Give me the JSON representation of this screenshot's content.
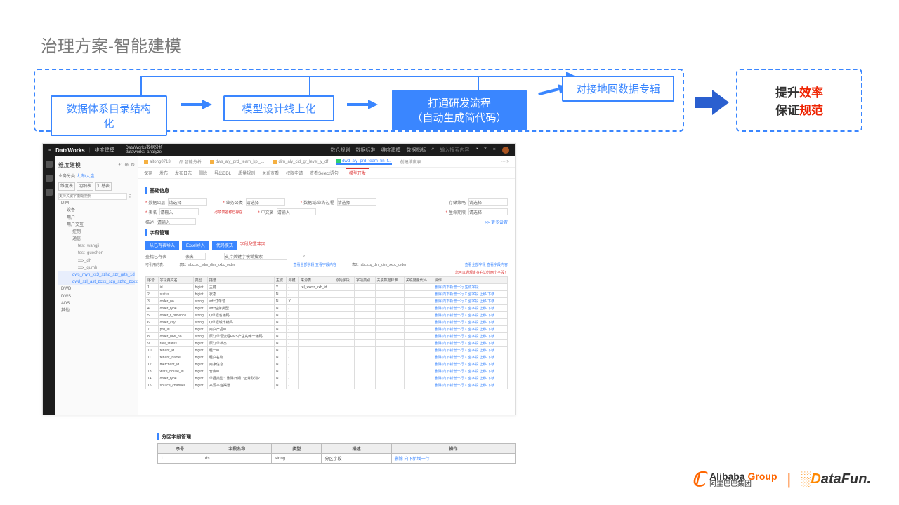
{
  "title": "治理方案-智能建模",
  "flow": {
    "step1": "数据体系目录结构化",
    "step2": "模型设计线上化",
    "step3_line1": "打通研发流程",
    "step3_line2": "（自动生成简代码）",
    "step4": "对接地图数据专辑"
  },
  "result": {
    "line1_black": "提升",
    "line1_red": "效率",
    "line2_black": "保证",
    "line2_red": "规范"
  },
  "mock": {
    "brand": "DataWorks",
    "brand_section": "维度建模",
    "project_line1": "DataWorks数据分析",
    "project_line2": "dataworks_analyze",
    "top_links": [
      "数仓规划",
      "数据标准",
      "维度建模",
      "数据指标"
    ],
    "search_placeholder": "输入搜索内容",
    "tree": {
      "header": "维度建模",
      "view_label": "业务分类",
      "view_value": "大淘/大盘",
      "side_tabs": [
        "维度表",
        "明细表",
        "汇总表"
      ],
      "DIM": "DIM",
      "DIM_children": [
        "设备",
        "用户"
      ],
      "user_inter": "用户交互",
      "user_inter_children": [
        "控制",
        "通信"
      ],
      "leaf_items": [
        "test_wangji",
        "test_guochen",
        "xxx_dh",
        "xxx_qumh"
      ],
      "active1": "dws_myn_xx3_szhd_szr_grts_1d",
      "active2": "dwd_szl_ast_zcxx_szg_szhd_zcxxx",
      "DWD": "DWD",
      "DWS": "DWS",
      "ADS": "ADS",
      "temp": "其他"
    },
    "tabs": [
      "aitong0713",
      "智能分析",
      "dws_aly_prd_team_kpi_...",
      "dim_aly_cid_gr_level_y_df",
      "dwd_aly_prd_team_fin_f...",
      "创建维度表"
    ],
    "ops": [
      "保存",
      "发布",
      "发布日志",
      "删除",
      "导出DDL",
      "质量规则",
      "关系查看",
      "权限申请",
      "查看Select语句"
    ],
    "ops_highlight": "模型开发",
    "section_basic": "基础信息",
    "form": {
      "data_domain_label": "数据公层",
      "data_domain_value": "请选择",
      "biz_type_label": "业务公类",
      "biz_type_value": "请选择",
      "data_bc_label": "数据域/业务过程",
      "data_bc_value": "请选择",
      "store_label": "存储策略",
      "store_value": "请选择",
      "table_name_label": "表名",
      "table_name_ph": "请输入",
      "table_name_warn": "必填表名称已存在",
      "cn_name_label": "中文名",
      "cn_name_ph": "请输入",
      "life_label": "生命期限",
      "life_value": "请选择",
      "desc_label": "描述",
      "desc_ph": "请输入",
      "more": ">> 更多设置"
    },
    "section_field": "字段管理",
    "field_btns": [
      "从已有表导入",
      "Excel导入",
      "代码模式"
    ],
    "field_warn_btn": "字段配置冲突",
    "filter_label": "查找已有表",
    "filter_type": "表名",
    "filter_ph": "支持关键字模糊搜索",
    "ref_label": "可引用的表:",
    "ref_value1": "表1：abcxxq_xdm_dim_xxbc_order",
    "ref_link1": "查看全部字段   查看字段内容",
    "ref_value2": "表2：abcxxq_dim_dim_xxbc_order",
    "ref_link2": "查看全部字段   查看字段内容",
    "ref_warn": "您可以通规定在右边分两个字段！",
    "table": {
      "headers": [
        "序号",
        "字段英文名",
        "类型",
        "描述",
        "主键",
        "外键",
        "来源表",
        "原始字段",
        "字段类别",
        "关联数据标准",
        "关联度量代码",
        "操作"
      ],
      "rows": [
        {
          "n": "1",
          "en": "id",
          "t": "bigint",
          "d": "主键",
          "pk": "Y",
          "fk": "-",
          "src": "rel_xxxxr_xxb_id",
          "ops": "删除 向下新增一行 生成字段"
        },
        {
          "n": "2",
          "en": "status",
          "t": "bigint",
          "d": "状态",
          "pk": "N",
          "fk": "-",
          "src": "",
          "ops": "删除 向下新增一行 X.全字段 上移 下移"
        },
        {
          "n": "3",
          "en": "order_no",
          "t": "string",
          "d": "adx订单号",
          "pk": "N",
          "fk": "Y",
          "src": "",
          "ops": "删除 向下新增一行 X.全字段 上移 下移"
        },
        {
          "n": "4",
          "en": "order_type",
          "t": "bigint",
          "d": "adx任务类型",
          "pk": "N",
          "fk": "-",
          "src": "",
          "ops": "删除 向下新增一行 X.全字段 上移 下移"
        },
        {
          "n": "5",
          "en": "order_f_province",
          "t": "string",
          "d": "Q单据省编码",
          "pk": "N",
          "fk": "-",
          "src": "",
          "ops": "删除 向下新增一行 X.全字段 上移 下移"
        },
        {
          "n": "6",
          "en": "order_city",
          "t": "string",
          "d": "Q单据城市编码",
          "pk": "N",
          "fk": "-",
          "src": "",
          "ops": "删除 向下新增一行 X.全字段 上移 下移"
        },
        {
          "n": "7",
          "en": "prd_id",
          "t": "bigint",
          "d": "商户产品id",
          "pk": "N",
          "fk": "-",
          "src": "",
          "ops": "删除 向下新增一行 X.全字段 上移 下移"
        },
        {
          "n": "8",
          "en": "order_raw_no",
          "t": "string",
          "d": "原订单号流程PMS产生的唯一编码",
          "pk": "N",
          "fk": "-",
          "src": "",
          "ops": "删除 向下新增一行 X.全字段 上移 下移"
        },
        {
          "n": "9",
          "en": "raw_status",
          "t": "bigint",
          "d": "原订单状态",
          "pk": "N",
          "fk": "-",
          "src": "",
          "ops": "删除 向下新增一行 X.全字段 上移 下移"
        },
        {
          "n": "10",
          "en": "tenant_id",
          "t": "bigint",
          "d": "租一id",
          "pk": "N",
          "fk": "-",
          "src": "",
          "ops": "删除 向下新增一行 X.全字段 上移 下移"
        },
        {
          "n": "11",
          "en": "tenant_name",
          "t": "bigint",
          "d": "租户名称",
          "pk": "N",
          "fk": "-",
          "src": "",
          "ops": "删除 向下新增一行 X.全字段 上移 下移"
        },
        {
          "n": "12",
          "en": "merchant_id",
          "t": "bigint",
          "d": "商家信息",
          "pk": "N",
          "fk": "-",
          "src": "",
          "ops": "删除 向下新增一行 X.全字段 上移 下移"
        },
        {
          "n": "13",
          "en": "ware_house_id",
          "t": "bigint",
          "d": "仓库id",
          "pk": "N",
          "fk": "-",
          "src": "",
          "ops": "删除 向下新增一行 X.全字段 上移 下移"
        },
        {
          "n": "14",
          "en": "order_type",
          "t": "bigint",
          "d": "单据类型：删除日期1:正常取消2",
          "pk": "N",
          "fk": "-",
          "src": "",
          "ops": "删除 向下新增一行 X.全字段 上移 下移"
        },
        {
          "n": "15",
          "en": "source_channel",
          "t": "bigint",
          "d": "来源平台渠道",
          "pk": "N",
          "fk": "-",
          "src": "",
          "ops": "删除 向下新增一行 X.全字段 上移 下移"
        }
      ]
    }
  },
  "partition": {
    "title": "分区字段管理",
    "headers": [
      "序号",
      "字段名称",
      "类型",
      "描述",
      "操作"
    ],
    "row": {
      "n": "1",
      "name": "ds",
      "type": "string",
      "desc": "分区字段",
      "ops": "删除  向下新增一行"
    }
  },
  "footer": {
    "alibaba_en_1": "Alibaba",
    "alibaba_en_2": "Group",
    "alibaba_cn": "阿里巴巴集团",
    "datafun_d": "D",
    "datafun_rest": "ataFun."
  }
}
